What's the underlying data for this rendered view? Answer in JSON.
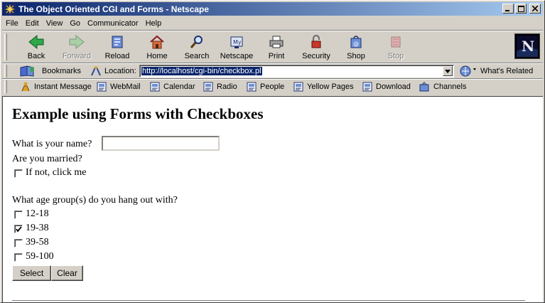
{
  "window": {
    "title": "The Object Oriented CGI and Forms - Netscape"
  },
  "menu": [
    "File",
    "Edit",
    "View",
    "Go",
    "Communicator",
    "Help"
  ],
  "navigation": {
    "back": "Back",
    "forward": "Forward",
    "reload": "Reload",
    "home": "Home",
    "search": "Search",
    "netscape": "Netscape",
    "print": "Print",
    "security": "Security",
    "shop": "Shop",
    "stop": "Stop"
  },
  "location_bar": {
    "bookmarks": "Bookmarks",
    "location_label": "Location:",
    "url": "http://localhost/cgi-bin/checkbox.pl",
    "whats_related": "What's Related"
  },
  "personal_toolbar": {
    "instant_message": "Instant Message",
    "webmail": "WebMail",
    "calendar": "Calendar",
    "radio": "Radio",
    "people": "People",
    "yellow_pages": "Yellow Pages",
    "download": "Download",
    "channels": "Channels"
  },
  "page": {
    "heading": "Example using Forms with Checkboxes",
    "name_prompt": "What is your name?",
    "name_value": "",
    "married_prompt": "Are you married?",
    "married_option": "If not, click me",
    "age_prompt": "What age group(s) do you hang out with?",
    "age_groups": [
      {
        "label": "12-18",
        "checked": false
      },
      {
        "label": "19-38",
        "checked": true
      },
      {
        "label": "39-58",
        "checked": false
      },
      {
        "label": "59-100",
        "checked": false
      }
    ],
    "select_button": "Select",
    "clear_button": "Clear"
  }
}
